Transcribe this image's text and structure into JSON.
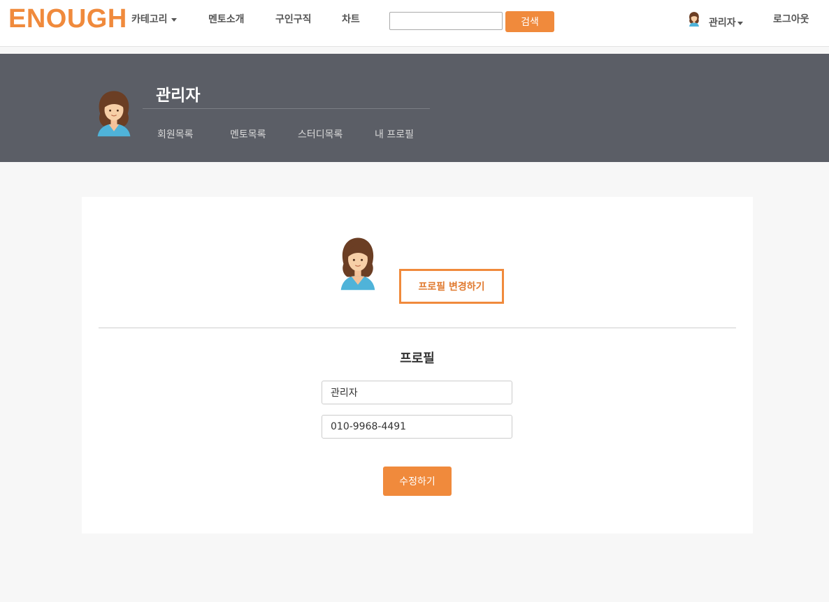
{
  "topnav": {
    "brand": "ENOUGH",
    "items": [
      {
        "label": "카테고리"
      },
      {
        "label": "멘토소개"
      },
      {
        "label": "구인구직"
      },
      {
        "label": "차트"
      }
    ],
    "search": {
      "placeholder": "",
      "value": "",
      "button_label": "검색"
    },
    "user_menu_label": "관리자",
    "logout_label": "로그아웃"
  },
  "banner": {
    "name": "관리자",
    "tabs": [
      {
        "label": "회원목록"
      },
      {
        "label": "멘토목록"
      },
      {
        "label": "스터디목록"
      },
      {
        "label": "내 프로필"
      }
    ]
  },
  "profile": {
    "change_button_label": "프로필 변경하기",
    "title": "프로필",
    "name_value": "관리자",
    "phone_value": "010-9968-4491",
    "submit_label": "수정하기"
  },
  "colors": {
    "accent": "#f08a3c",
    "banner_bg": "#5b5e66",
    "page_bg": "#f7f7f7"
  },
  "icons": {
    "avatar": "avatar-woman-icon",
    "dropdown": "caret-down-icon"
  }
}
